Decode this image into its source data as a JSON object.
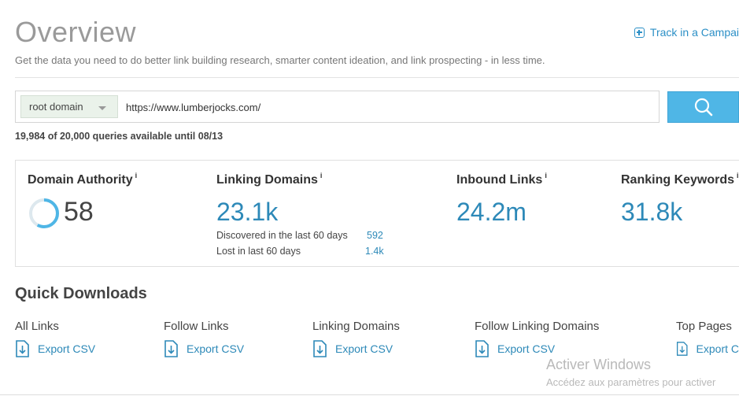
{
  "header": {
    "title": "Overview",
    "track_label": "Track in a Campai",
    "subtitle": "Get the data you need to do better link building research, smarter content ideation, and link prospecting - in less time."
  },
  "search": {
    "scope_selected": "root domain",
    "url_value": "https://www.lumberjocks.com/",
    "queries_text": "19,984 of 20,000 queries available until 08/13"
  },
  "metrics": {
    "domain_authority": {
      "label": "Domain Authority",
      "info": "i",
      "value": "58",
      "gauge_fraction": 0.58
    },
    "linking_domains": {
      "label": "Linking Domains",
      "info": "i",
      "value": "23.1k",
      "discovered_label": "Discovered in the last 60 days",
      "discovered_value": "592",
      "lost_label": "Lost in last 60 days",
      "lost_value": "1.4k"
    },
    "inbound_links": {
      "label": "Inbound Links",
      "info": "i",
      "value": "24.2m"
    },
    "ranking_keywords": {
      "label": "Ranking Keywords",
      "info": "i",
      "value": "31.8k"
    }
  },
  "quick_downloads": {
    "title": "Quick Downloads",
    "items": [
      {
        "label": "All Links",
        "export": "Export CSV"
      },
      {
        "label": "Follow Links",
        "export": "Export CSV"
      },
      {
        "label": "Linking Domains",
        "export": "Export CSV"
      },
      {
        "label": "Follow Linking Domains",
        "export": "Export CSV"
      },
      {
        "label": "Top Pages",
        "export": "Export C"
      }
    ]
  },
  "watermark": {
    "line1": "Activer Windows",
    "line2": "Accédez aux paramètres pour activer"
  },
  "colors": {
    "accent": "#2d89b8",
    "search_button": "#4fb6e6",
    "gauge": "#4fb6e6",
    "gauge_track": "#dde8ee"
  },
  "icons": {
    "track": "plus-square-icon",
    "search": "search-icon",
    "export": "download-file-icon",
    "dropdown": "chevron-down-icon"
  }
}
